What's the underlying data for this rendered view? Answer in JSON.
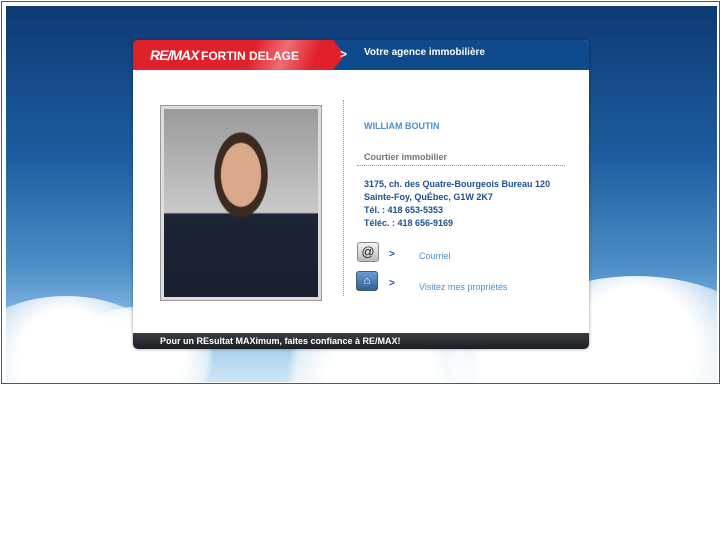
{
  "header": {
    "logo": "RE/MAX",
    "agency": "FORTIN DELAGE",
    "tagline": "Votre agence immobilière"
  },
  "agent": {
    "name": "WILLIAM BOUTIN",
    "role": "Courtier immobilier",
    "address_line1": "3175, ch. des Quatre-Bourgeois Bureau 120",
    "address_line2": "Sainte-Foy, QuÉbec, G1W 2K7",
    "phone": "Tél. : 418 653-5353",
    "fax": "Téléc. : 418 656-9169"
  },
  "links": [
    {
      "label": "Courriel",
      "icon": "email-icon"
    },
    {
      "label": "Visitez mes propriétés",
      "icon": "house-icon"
    }
  ],
  "footer": {
    "text": "Pour un REsultat MAXimum, faites confiance à RE/MAX!"
  },
  "colors": {
    "red": "#e0202a",
    "blue": "#0f4a8c",
    "link": "#4a8fd2"
  }
}
